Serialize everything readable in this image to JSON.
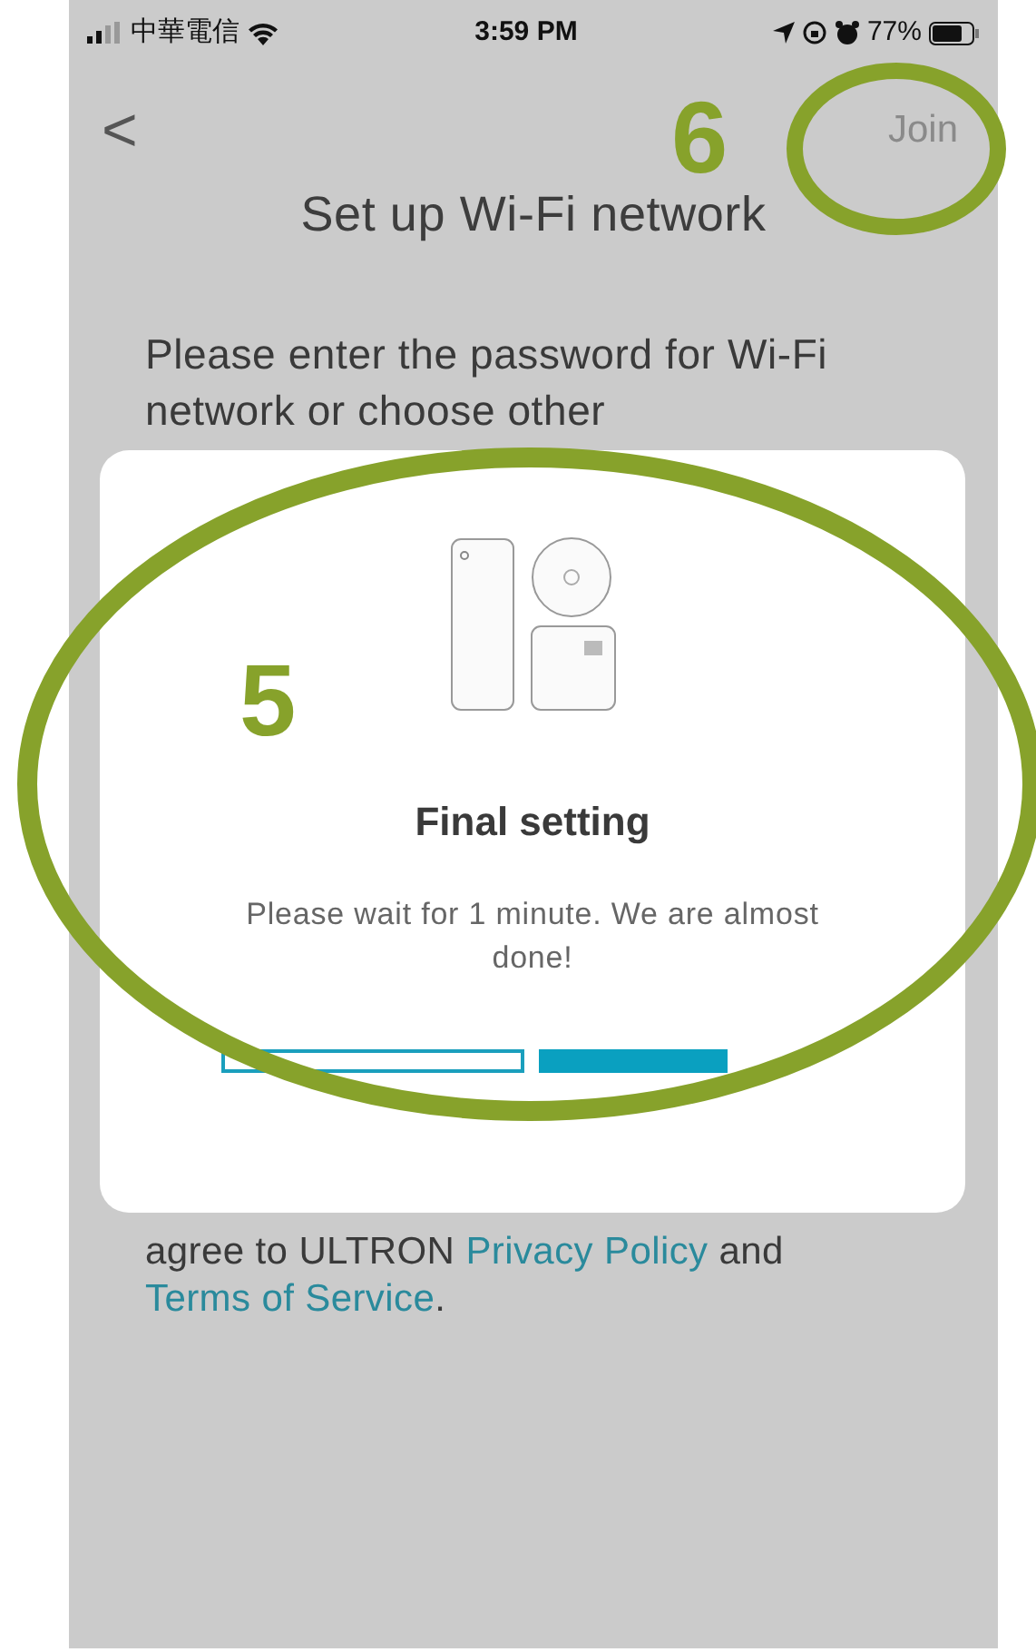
{
  "status_bar": {
    "carrier": "中華電信",
    "time": "3:59 PM",
    "battery": "77%"
  },
  "nav": {
    "back": "<",
    "action": "Join",
    "title": "Set up Wi-Fi network"
  },
  "instructions": "Please enter the password for Wi-Fi network or choose other",
  "dialog": {
    "title": "Final setting",
    "message": "Please wait for 1 minute. We are almost done!",
    "progress_segments": [
      {
        "filled": false
      },
      {
        "filled": true
      }
    ]
  },
  "terms": {
    "text": "agree to ULTRON",
    "link_1": "Privacy Policy",
    "joiner": "and",
    "link_2": "Terms of Service",
    "end": "."
  },
  "annotations": [
    {
      "label": "5",
      "kind": "large"
    },
    {
      "label": "6",
      "kind": "small"
    }
  ]
}
